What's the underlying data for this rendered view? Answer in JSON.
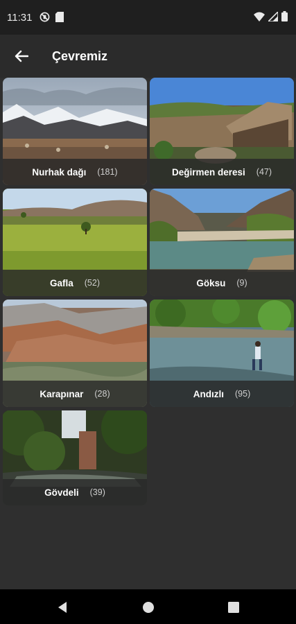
{
  "status_bar": {
    "time": "11:31",
    "left_icons": [
      "no-sim-icon",
      "sd-card-icon"
    ],
    "right_icons": [
      "wifi-icon",
      "cellular-signal-icon",
      "battery-icon"
    ]
  },
  "app_bar": {
    "title": "Çevremiz",
    "back_icon": "arrow-left-icon"
  },
  "places": [
    {
      "name": "Nurhak dağı",
      "count": "(181)",
      "theme": "snow-mountain"
    },
    {
      "name": "Değirmen deresi",
      "count": "(47)",
      "theme": "ruins"
    },
    {
      "name": "Gafla",
      "count": "(52)",
      "theme": "meadow"
    },
    {
      "name": "Göksu",
      "count": "(9)",
      "theme": "river-canyon"
    },
    {
      "name": "Karapınar",
      "count": "(28)",
      "theme": "rocks"
    },
    {
      "name": "Andızlı",
      "count": "(95)",
      "theme": "stream"
    },
    {
      "name": "Gövdeli",
      "count": "(39)",
      "theme": "forest-creek"
    }
  ],
  "colors": {
    "background": "#2f2f2f",
    "app_bar": "#2b2b2b",
    "status_bar": "#1f1f1f",
    "nav_bar": "#000000"
  },
  "nav_bar": {
    "buttons": [
      "back-triangle-icon",
      "home-circle-icon",
      "recents-square-icon"
    ]
  }
}
